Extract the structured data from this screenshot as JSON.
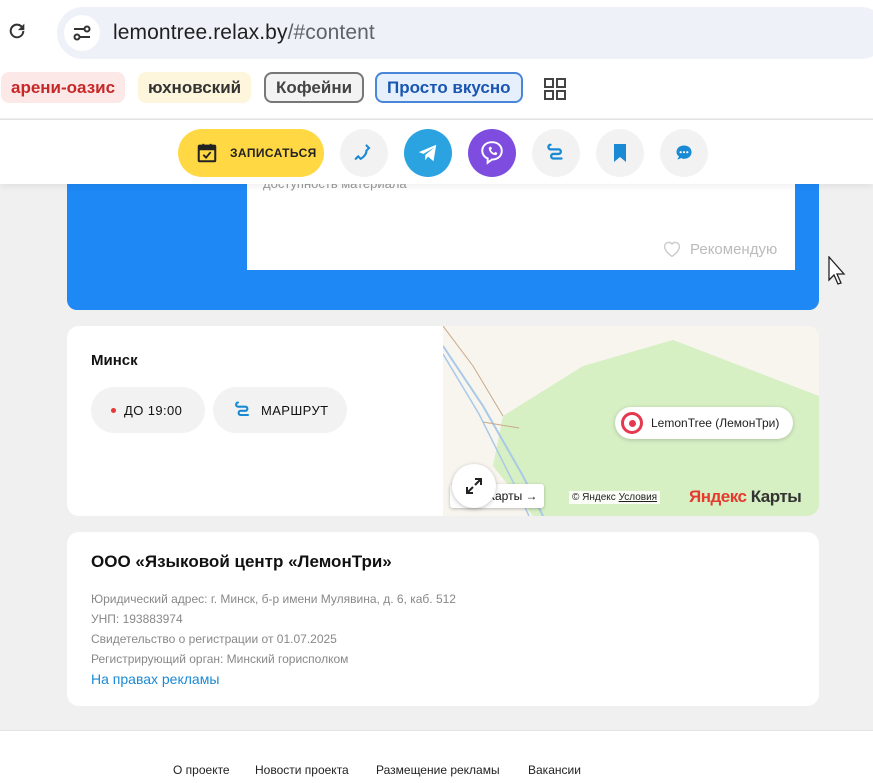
{
  "browser": {
    "url_host": "lemontree.relax.by",
    "url_path": "/#content",
    "bookmarks": [
      "арени-оазис",
      "юхновский",
      "Кофейни",
      "Просто вкусно"
    ]
  },
  "actionbar": {
    "book_label": "ЗАПИСАТЬСЯ",
    "icons": [
      "phone-icon",
      "telegram-icon",
      "viber-icon",
      "route-icon",
      "bookmark-icon",
      "chat-icon"
    ],
    "colors": {
      "book": "#ffd843",
      "telegram": "#2aa3e0",
      "viber": "#7f4ce0",
      "accent": "#1a8ad4"
    }
  },
  "article": {
    "partial_text": "доступность материала",
    "recommend_label": "Рекомендую"
  },
  "location": {
    "city": "Минск",
    "hours_label": "ДО 19:00",
    "route_label": "МАРШРУТ",
    "map": {
      "marker_label": "LemonTree (ЛемонТри)",
      "maps_button": "Карты →",
      "copyright": "© Яндекс",
      "terms": "Условия",
      "logo_first": "Яндекс",
      "logo_second": "Карты"
    }
  },
  "company": {
    "name": "ООО «Языковой центр «ЛемонТри»",
    "lines": [
      "Юридический адрес: г. Минск, б-р имени Мулявина, д. 6, каб. 512",
      "УНП: 193883974",
      "Свидетельство о регистрации от 01.07.2025",
      "Регистрирующий орган: Минский горисполком"
    ],
    "ad_link": "На правах рекламы"
  },
  "footer": {
    "links": [
      "О проекте",
      "Новости проекта",
      "Размещение рекламы",
      "Вакансии"
    ]
  }
}
